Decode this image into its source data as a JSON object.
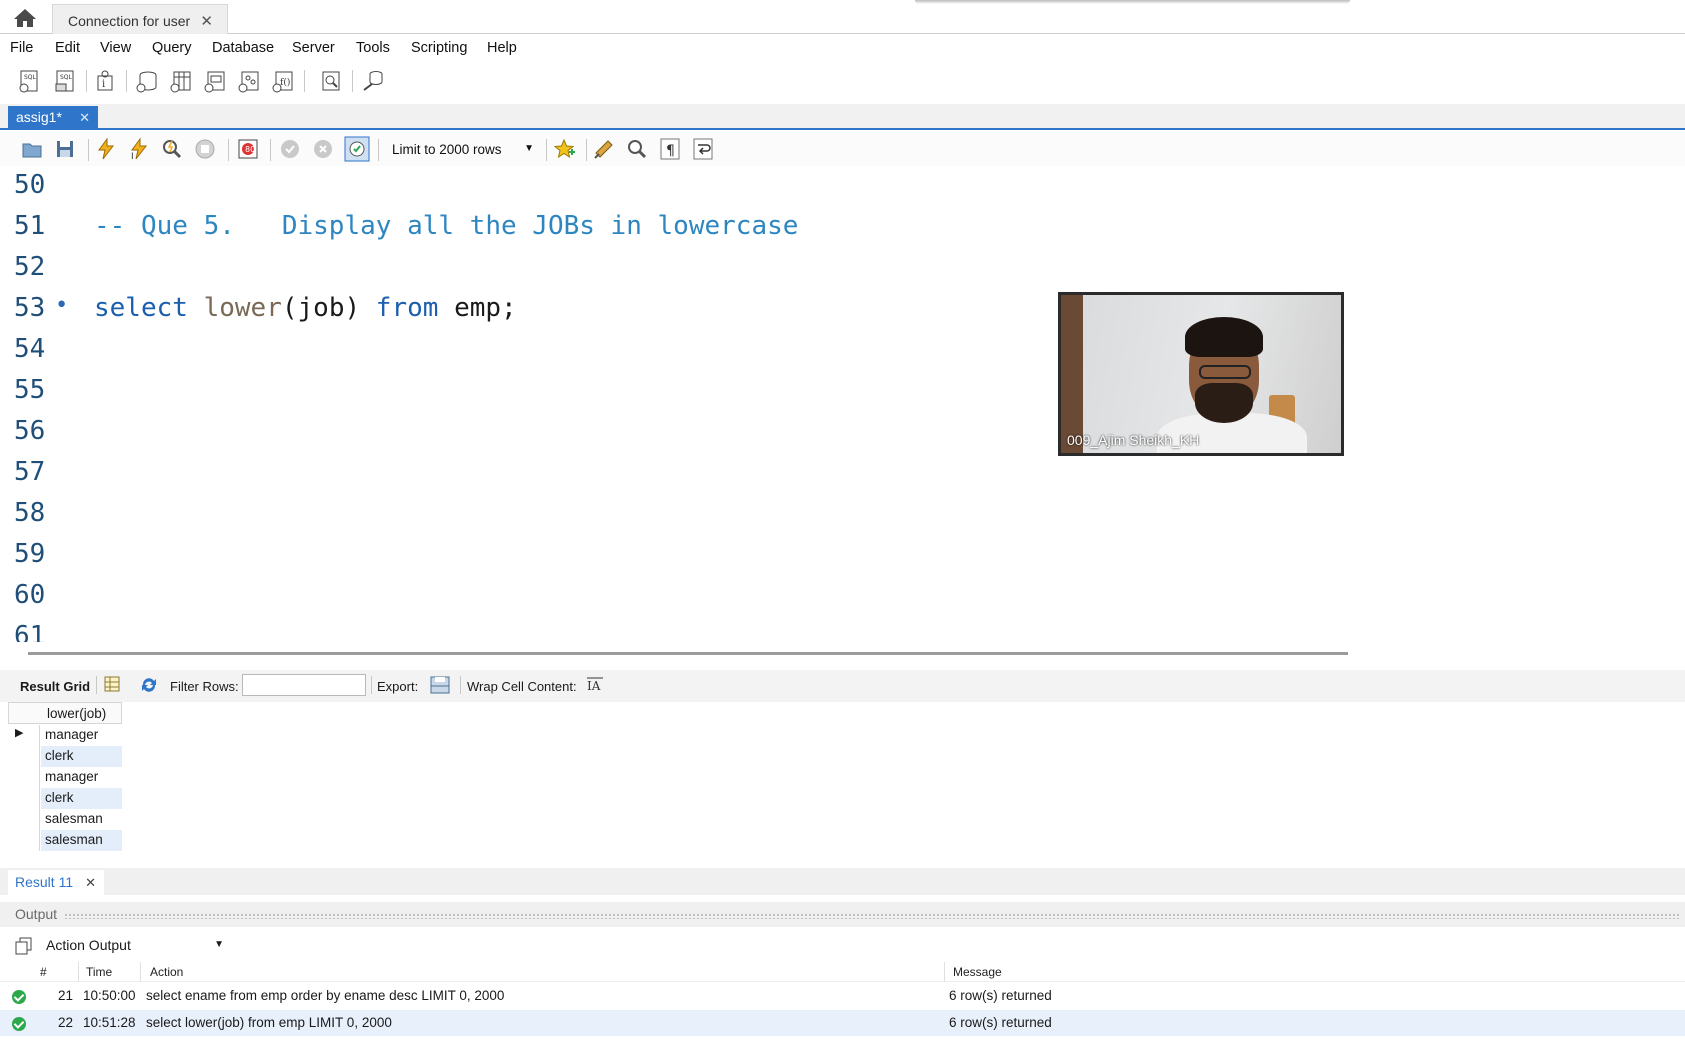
{
  "connection_tab": {
    "label": "Connection for user",
    "close": "✕"
  },
  "menu": [
    "File",
    "Edit",
    "View",
    "Query",
    "Database",
    "Server",
    "Tools",
    "Scripting",
    "Help"
  ],
  "query_tab": {
    "label": "assig1*",
    "close": "✕"
  },
  "sql_toolbar": {
    "limit_label": "Limit to 2000 rows"
  },
  "editor": {
    "line_numbers": [
      "50",
      "51",
      "52",
      "53",
      "54",
      "55",
      "56",
      "57",
      "58",
      "59",
      "60",
      "61"
    ],
    "comment": "-- Que 5.   Display all the JOBs in lowercase",
    "stmt_select": "select",
    "stmt_fn": "lower",
    "stmt_args": "(job)",
    "stmt_from": "from",
    "stmt_table": "emp;"
  },
  "video": {
    "participant_name": "009_Ajim Sheikh_KH"
  },
  "result_toolbar": {
    "result_grid": "Result Grid",
    "filter_rows": "Filter Rows:",
    "export": "Export:",
    "wrap_cell": "Wrap Cell Content:"
  },
  "grid": {
    "column": "lower(job)",
    "rows": [
      "manager",
      "clerk",
      "manager",
      "clerk",
      "salesman",
      "salesman"
    ]
  },
  "result_tab": {
    "label": "Result 11",
    "close": "✕"
  },
  "output": {
    "header": "Output",
    "selector": "Action Output",
    "columns": {
      "num": "#",
      "time": "Time",
      "action": "Action",
      "message": "Message"
    },
    "rows": [
      {
        "num": "21",
        "time": "10:50:00",
        "action": "select ename from emp order by ename desc LIMIT 0, 2000",
        "message": "6 row(s) returned"
      },
      {
        "num": "22",
        "time": "10:51:28",
        "action": "select lower(job) from emp LIMIT 0, 2000",
        "message": "6 row(s) returned"
      }
    ]
  },
  "colors": {
    "accent": "#2f75c9",
    "success": "#2aa84a",
    "keyword": "#1c5fae",
    "comment": "#2e86c1"
  }
}
